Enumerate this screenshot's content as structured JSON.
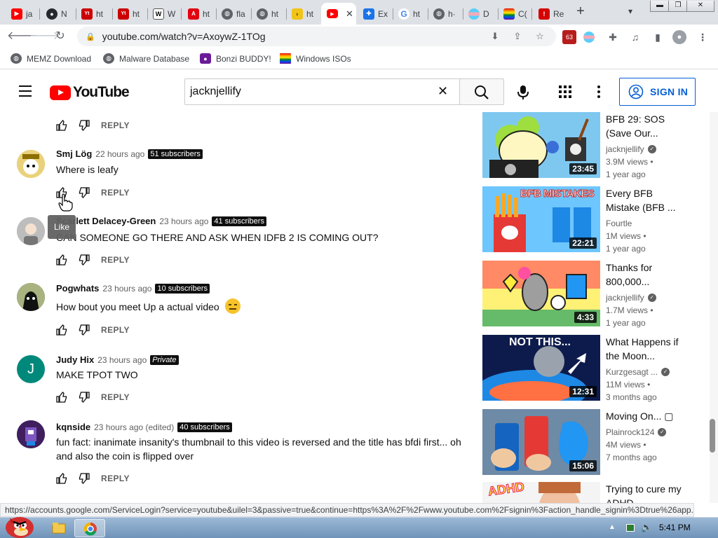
{
  "browser": {
    "tabs": [
      {
        "label": "ja",
        "favicon": "youtube-icon"
      },
      {
        "label": "N",
        "favicon": "github-icon"
      },
      {
        "label": "ht",
        "favicon": "youtube-icon"
      },
      {
        "label": "ht",
        "favicon": "youtube-icon"
      },
      {
        "label": "W",
        "favicon": "wikipedia-icon"
      },
      {
        "label": "ht",
        "favicon": "adobe-icon"
      },
      {
        "label": "fla",
        "favicon": "globe-icon"
      },
      {
        "label": "ht",
        "favicon": "globe-icon"
      },
      {
        "label": "ht",
        "favicon": "banana-icon"
      },
      {
        "label": "",
        "favicon": "youtube-icon",
        "active": true
      },
      {
        "label": "Ex",
        "favicon": "puzzle-icon"
      },
      {
        "label": "ht",
        "favicon": "google-icon"
      },
      {
        "label": "h·",
        "favicon": "globe-icon"
      },
      {
        "label": "D",
        "favicon": "flag-icon"
      },
      {
        "label": "C(",
        "favicon": "rainbow-icon"
      },
      {
        "label": "Re",
        "favicon": "red-icon"
      }
    ],
    "new_tab": "+",
    "url": "youtube.com/watch?v=AxoywZ-1TOg",
    "extension_badge": "63",
    "bookmarks": [
      {
        "label": "MEMZ Download",
        "icon": "globe-icon"
      },
      {
        "label": "Malware Database",
        "icon": "globe-icon"
      },
      {
        "label": "Bonzi BUDDY!",
        "icon": "bonzi-icon"
      },
      {
        "label": "Windows ISOs",
        "icon": "windows-flag-icon"
      }
    ],
    "status_url": "https://accounts.google.com/ServiceLogin?service=youtube&uilel=3&passive=true&continue=https%3A%2F%2Fwww.youtube.com%2Fsignin%3Faction_handle_signin%3Dtrue%26app..."
  },
  "youtube": {
    "logo_text": "YouTube",
    "search_value": "jacknjellify",
    "sign_in_label": "SIGN IN",
    "reply_label": "REPLY",
    "tooltip": "Like"
  },
  "comments": [
    {
      "author": "Smj Lög",
      "time": "22 hours ago",
      "subs": "51 subscribers",
      "text": "Where  is leafy",
      "avatar_color": "#c9a227"
    },
    {
      "author": "Scarlett Delacey-Green",
      "time": "23 hours ago",
      "subs": "41 subscribers",
      "text": "CAN SOMEONE GO THERE AND ASK WHEN IDFB 2 IS COMING OUT?",
      "avatar_color": "#9e9e9e"
    },
    {
      "author": "Pogwhats",
      "time": "23 hours ago",
      "subs": "10 subscribers",
      "text": "How bout you meet Up a actual video",
      "emoji": "😑",
      "avatar_color": "#3d4a2a"
    },
    {
      "author": "Judy Hix",
      "time": "23 hours ago",
      "private": "Private",
      "text": "MAKE TPOT TWO",
      "avatar_letter": "J",
      "avatar_color": "#00897b"
    },
    {
      "author": "kqnside",
      "time": "23 hours ago (edited)",
      "subs": "40 subscribers",
      "text": "fun fact: inanimate insanity's thumbnail to this video is reversed and the title has bfdi first... oh and also the coin is flipped over",
      "avatar_color": "#4a2a6a"
    }
  ],
  "related": [
    {
      "title": "BFB 29: SOS (Save Our...",
      "channel": "jacknjellify",
      "verified": true,
      "views": "3.9M views",
      "age": "1 year ago",
      "duration": "23:45"
    },
    {
      "title": "Every BFB Mistake (BFB ...",
      "channel": "Fourtle",
      "verified": false,
      "views": "1M views",
      "age": "1 year ago",
      "duration": "22:21",
      "thumb_text": "BFB MISTAKES"
    },
    {
      "title": "Thanks for 800,000...",
      "channel": "jacknjellify",
      "verified": true,
      "views": "1.7M views",
      "age": "1 year ago",
      "duration": "4:33"
    },
    {
      "title": "What Happens if the Moon...",
      "channel": "Kurzgesagt ...",
      "verified": true,
      "views": "11M views",
      "age": "3 months ago",
      "duration": "12:31",
      "thumb_text": "NOT THIS..."
    },
    {
      "title": "Moving On... ▢",
      "channel": "Plainrock124",
      "verified": true,
      "views": "4M views",
      "age": "7 months ago",
      "duration": "15:06"
    },
    {
      "title": "Trying to cure my ADHD...",
      "channel": "",
      "verified": false,
      "views": "",
      "age": "",
      "duration": "",
      "thumb_text": "ADHD"
    }
  ],
  "taskbar": {
    "clock": "5:41 PM"
  },
  "colors": {
    "yt_red": "#ff0000",
    "sign_in_blue": "#065fd4",
    "tab_strip": "#dee1e6"
  }
}
